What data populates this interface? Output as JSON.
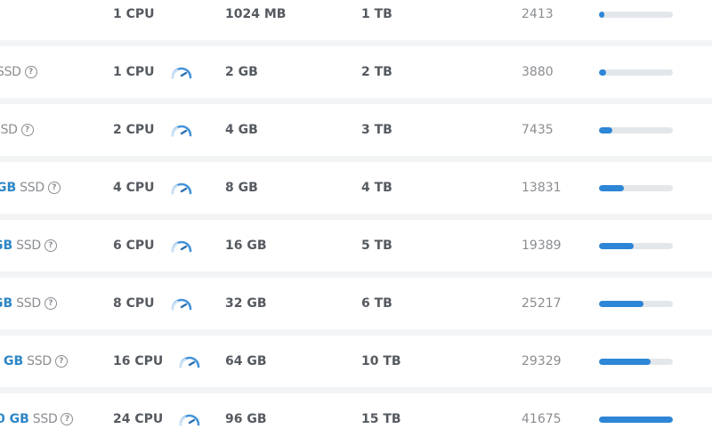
{
  "colors": {
    "accent": "#2d86d6",
    "disk_size_text": "#2d86c6",
    "strong_text": "#555a60",
    "muted_text": "#8a8d91",
    "bar_track": "#e4e7ea",
    "row_bg": "#ffffff",
    "divider": "#f3f4f5"
  },
  "benchmark_max": 41675,
  "rows": [
    {
      "disk_size": "",
      "disk_type": "",
      "has_help": false,
      "cpu": "1 CPU",
      "has_gauge": false,
      "ram": "1024 MB",
      "bandwidth": "1 TB",
      "score": "2413",
      "score_fraction": 0.058
    },
    {
      "disk_size": "",
      "disk_type": "SSD",
      "has_help": true,
      "cpu": "1 CPU",
      "has_gauge": true,
      "ram": "2 GB",
      "bandwidth": "2 TB",
      "score": "3880",
      "score_fraction": 0.093
    },
    {
      "disk_size": "",
      "disk_type": "SSD",
      "has_help": true,
      "cpu": "2 CPU",
      "has_gauge": true,
      "ram": "4 GB",
      "bandwidth": "3 TB",
      "score": "7435",
      "score_fraction": 0.178
    },
    {
      "disk_size": "GB",
      "disk_type": "SSD",
      "has_help": true,
      "cpu": "4 CPU",
      "has_gauge": true,
      "ram": "8 GB",
      "bandwidth": "4 TB",
      "score": "13831",
      "score_fraction": 0.332
    },
    {
      "disk_size": "GB",
      "disk_type": "SSD",
      "has_help": true,
      "cpu": "6 CPU",
      "has_gauge": true,
      "ram": "16 GB",
      "bandwidth": "5 TB",
      "score": "19389",
      "score_fraction": 0.465
    },
    {
      "disk_size": "GB",
      "disk_type": "SSD",
      "has_help": true,
      "cpu": "8 CPU",
      "has_gauge": true,
      "ram": "32 GB",
      "bandwidth": "6 TB",
      "score": "25217",
      "score_fraction": 0.605
    },
    {
      "disk_size": "GB",
      "disk_type": "SSD",
      "has_help": true,
      "cpu": "16 CPU",
      "has_gauge": true,
      "ram": "64 GB",
      "bandwidth": "10 TB",
      "score": "29329",
      "score_fraction": 0.704
    },
    {
      "disk_size": "0 GB",
      "disk_type": "SSD",
      "has_help": true,
      "cpu": "24 CPU",
      "has_gauge": true,
      "ram": "96 GB",
      "bandwidth": "15 TB",
      "score": "41675",
      "score_fraction": 1.0
    }
  ],
  "help_glyph": "?"
}
